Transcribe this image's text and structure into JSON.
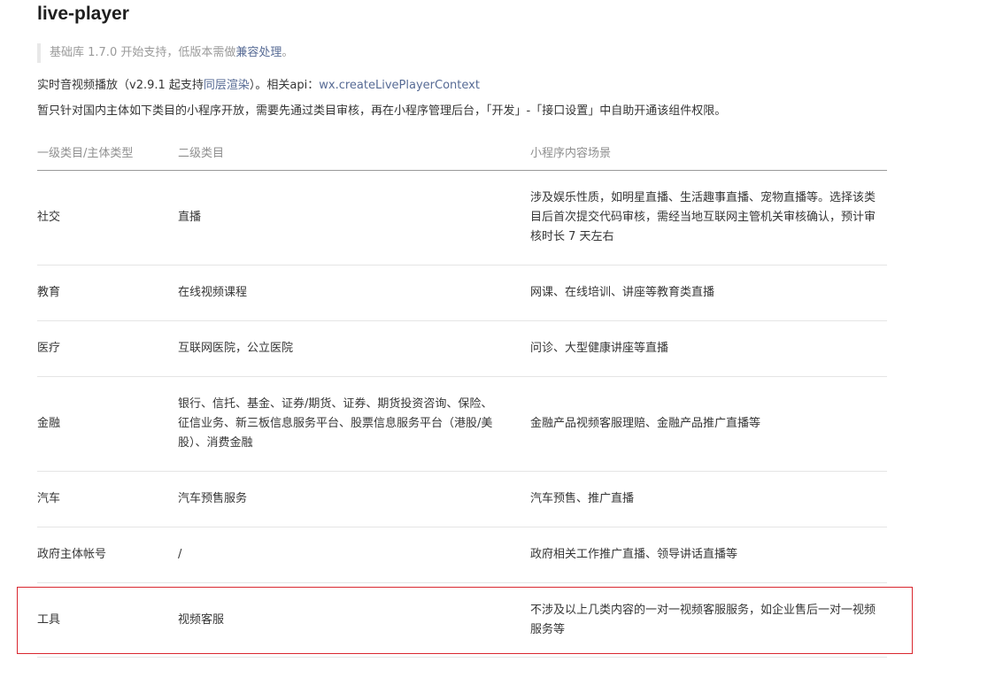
{
  "page": {
    "title": "live-player"
  },
  "notice": {
    "prefix": "基础库 1.7.0 开始支持，低版本需做",
    "link": "兼容处理",
    "suffix": "。"
  },
  "description": {
    "line1_prefix": "实时音视频播放（v2.9.1 起支持",
    "line1_link": "同层渲染",
    "line1_middle": "）。相关api：",
    "line1_api": "wx.createLivePlayerContext",
    "line2": "暂只针对国内主体如下类目的小程序开放，需要先通过类目审核，再在小程序管理后台，「开发」-「接口设置」中自助开通该组件权限。"
  },
  "table": {
    "headers": [
      "一级类目/主体类型",
      "二级类目",
      "小程序内容场景"
    ],
    "rows": [
      {
        "c1": "社交",
        "c2": "直播",
        "c3": "涉及娱乐性质，如明星直播、生活趣事直播、宠物直播等。选择该类目后首次提交代码审核，需经当地互联网主管机关审核确认，预计审核时长 7 天左右"
      },
      {
        "c1": "教育",
        "c2": "在线视频课程",
        "c3": "网课、在线培训、讲座等教育类直播"
      },
      {
        "c1": "医疗",
        "c2": "互联网医院，公立医院",
        "c3": "问诊、大型健康讲座等直播"
      },
      {
        "c1": "金融",
        "c2": "银行、信托、基金、证券/期货、证券、期货投资咨询、保险、征信业务、新三板信息服务平台、股票信息服务平台（港股/美股）、消费金融",
        "c3": "金融产品视频客服理赔、金融产品推广直播等"
      },
      {
        "c1": "汽车",
        "c2": "汽车预售服务",
        "c3": "汽车预售、推广直播"
      },
      {
        "c1": "政府主体帐号",
        "c2": "/",
        "c3": "政府相关工作推广直播、领导讲话直播等"
      },
      {
        "c1": "工具",
        "c2": "视频客服",
        "c3": "不涉及以上几类内容的一对一视频客服服务，如企业售后一对一视频服务等"
      }
    ]
  },
  "colors": {
    "link": "#576b95",
    "highlight_border": "#d9272f",
    "header_text": "#8f8f8f"
  }
}
